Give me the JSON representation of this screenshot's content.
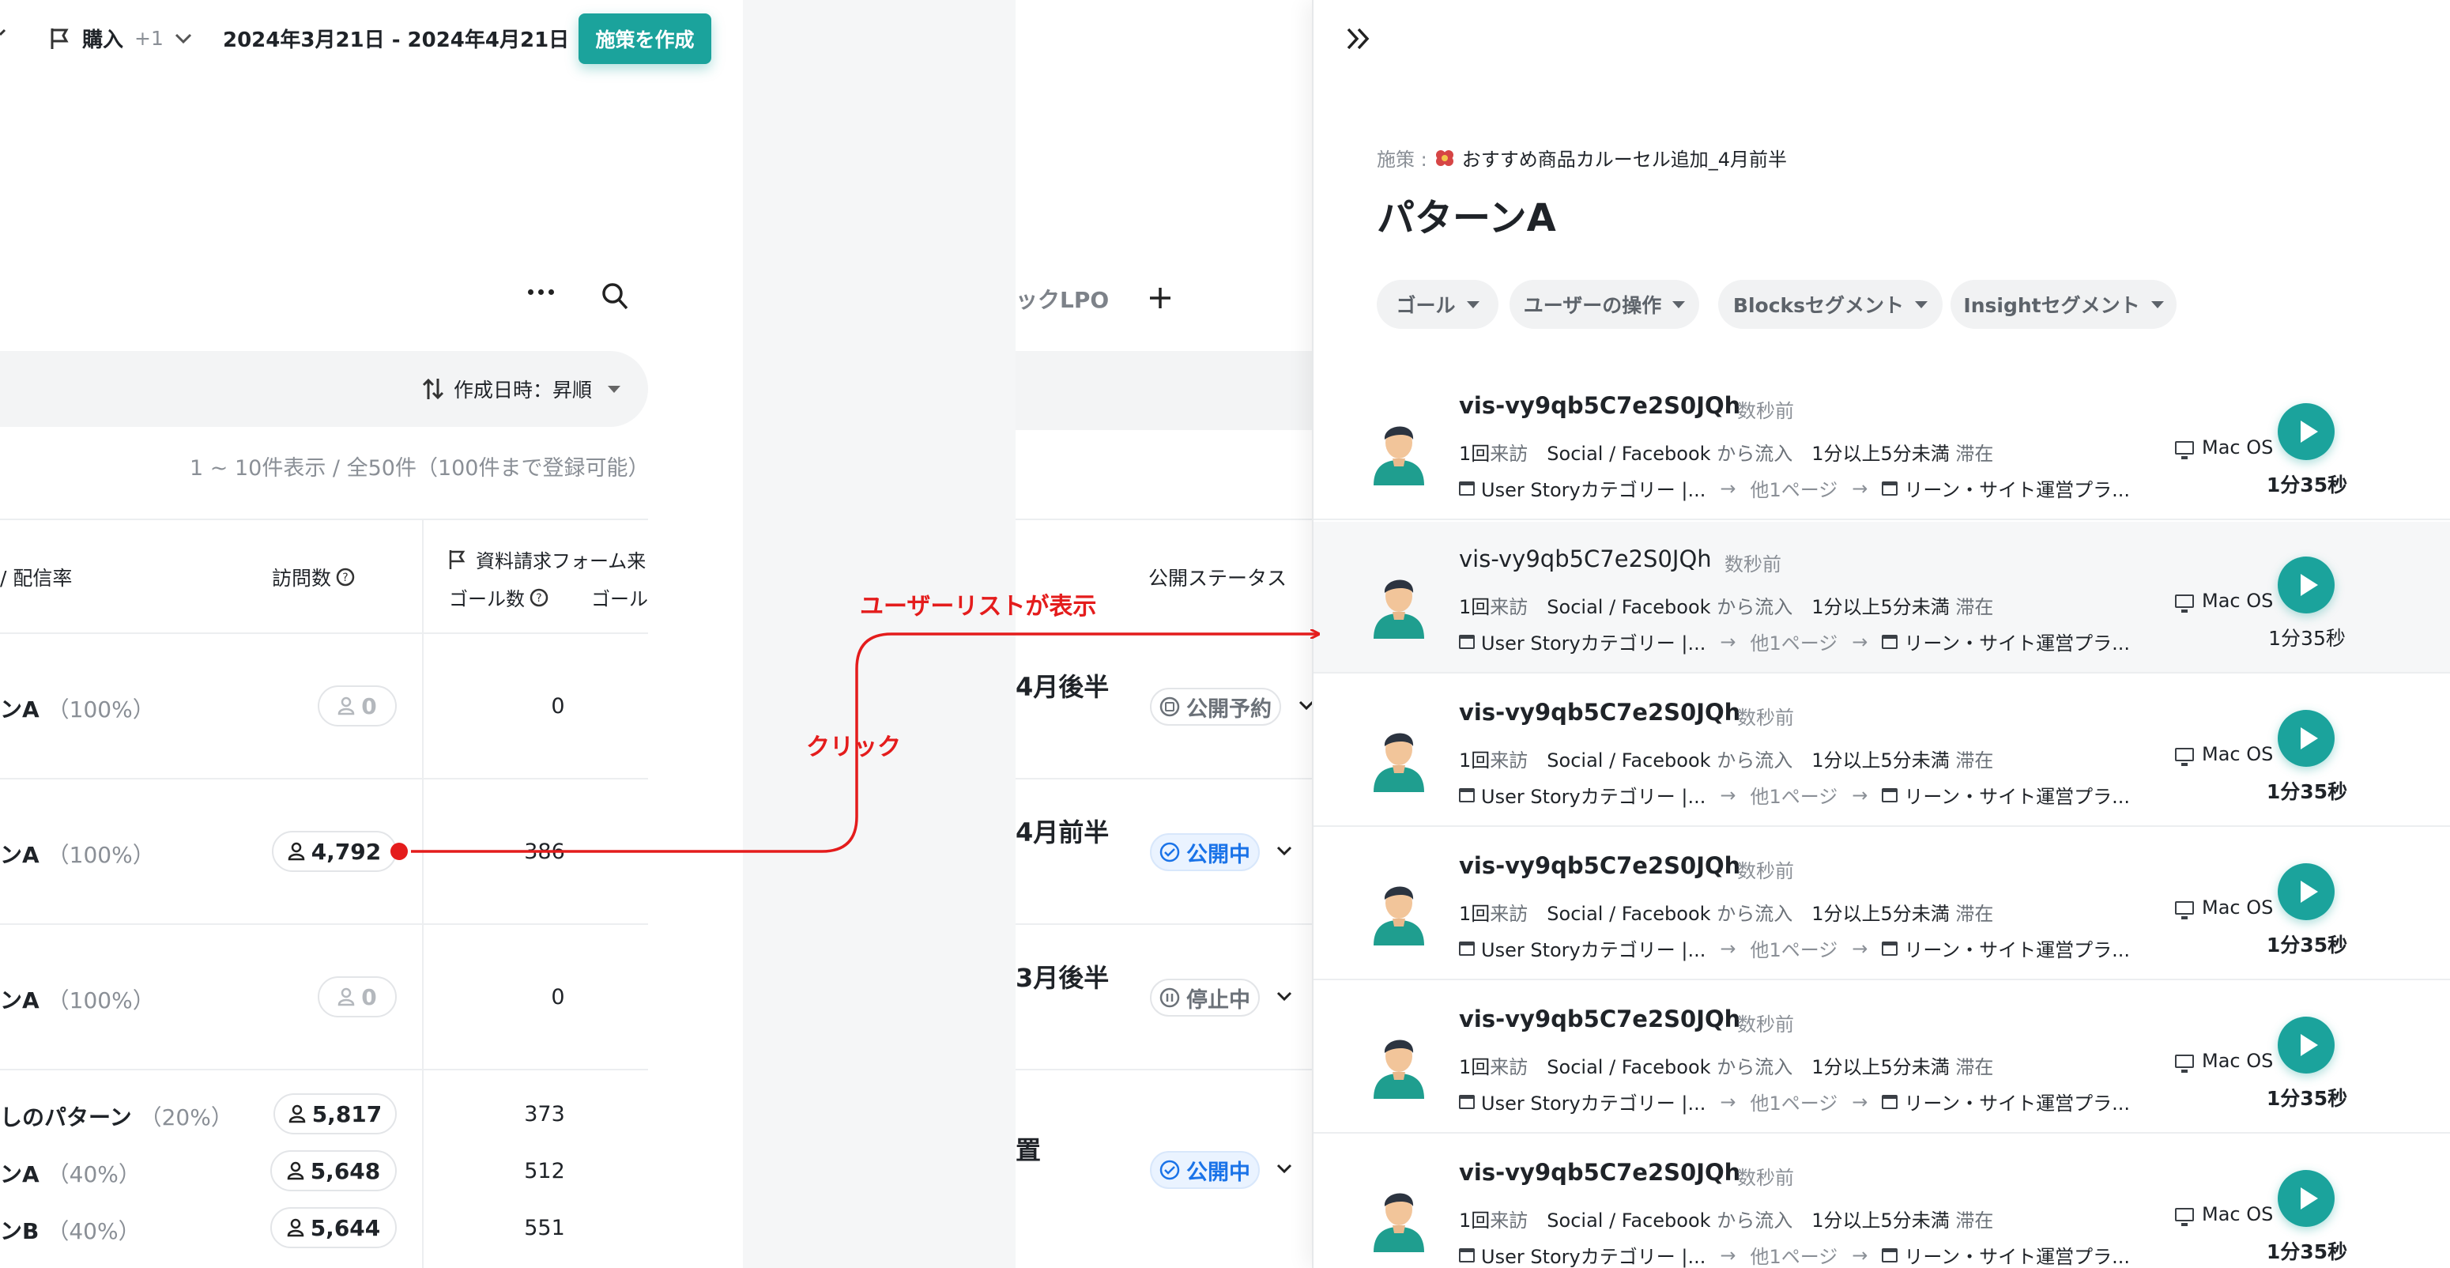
{
  "topbar": {
    "goal_label": "購入",
    "goal_extra": "+1",
    "date_range": "2024年3月21日 - 2024年4月21日",
    "create_button": "施策を作成"
  },
  "list": {
    "sort_label": "作成日時：昇順",
    "count_text": "1 ~ 10件表示 / 全50件（100件まで登録可能）",
    "headers": {
      "pattern_rate": "/ 配信率",
      "visits": "訪問数",
      "goal_form": "資料請求フォーム来",
      "goal_count": "ゴール数",
      "goal_trunc": "ゴール"
    },
    "rows": [
      {
        "name": "ンA",
        "pct": "（100%）",
        "visits": "0",
        "goals": "0"
      },
      {
        "name": "ンA",
        "pct": "（100%）",
        "visits": "4,792",
        "goals": "386"
      },
      {
        "name": "ンA",
        "pct": "（100%）",
        "visits": "0",
        "goals": "0"
      },
      {
        "name": "しのパターン",
        "pct": "（20%）",
        "visits": "5,817",
        "goals": "373"
      },
      {
        "name": "ンA",
        "pct": "（40%）",
        "visits": "5,648",
        "goals": "512"
      },
      {
        "name": "ンB",
        "pct": "（40%）",
        "visits": "5,644",
        "goals": "551"
      }
    ]
  },
  "center": {
    "tab_partial": "ックLPO",
    "status_header": "公開ステータス",
    "campaigns": [
      {
        "title": "4月後半",
        "status": "公開予約"
      },
      {
        "title": "4月前半",
        "status": "公開中"
      },
      {
        "title": "3月後半",
        "status": "停止中"
      },
      {
        "title": "置",
        "status": "公開中"
      }
    ]
  },
  "annotations": {
    "click": "クリック",
    "user_list_shown": "ユーザーリストが表示"
  },
  "panel": {
    "campaign_prefix": "施策 :",
    "campaign_name": "おすすめ商品カルーセル追加_4月前半",
    "title": "パターンA",
    "filters": [
      "ゴール",
      "ユーザーの操作",
      "Blocksセグメント",
      "Insightセグメント"
    ],
    "users": [
      {
        "id": "vis-vy9qb5C7e2S0JQh",
        "when": "数秒前",
        "visits_n": "1回",
        "visits_u": "来訪",
        "source": "Social / Facebook",
        "source_suffix": "から流入",
        "stay": "1分以上5分未満",
        "stay_suffix": "滞在",
        "page_from": "User Storyカテゴリー |...",
        "page_mid": "他1ページ",
        "page_to": "リーン・サイト運営プラ...",
        "os": "Mac OS",
        "duration": "1分35秒"
      },
      {
        "id": "vis-vy9qb5C7e2S0JQh",
        "when": "数秒前",
        "visits_n": "1回",
        "visits_u": "来訪",
        "source": "Social / Facebook",
        "source_suffix": "から流入",
        "stay": "1分以上5分未満",
        "stay_suffix": "滞在",
        "page_from": "User Storyカテゴリー |...",
        "page_mid": "他1ページ",
        "page_to": "リーン・サイト運営プラ...",
        "os": "Mac OS",
        "duration": "1分35秒"
      },
      {
        "id": "vis-vy9qb5C7e2S0JQh",
        "when": "数秒前",
        "visits_n": "1回",
        "visits_u": "来訪",
        "source": "Social / Facebook",
        "source_suffix": "から流入",
        "stay": "1分以上5分未満",
        "stay_suffix": "滞在",
        "page_from": "User Storyカテゴリー |...",
        "page_mid": "他1ページ",
        "page_to": "リーン・サイト運営プラ...",
        "os": "Mac OS",
        "duration": "1分35秒"
      },
      {
        "id": "vis-vy9qb5C7e2S0JQh",
        "when": "数秒前",
        "visits_n": "1回",
        "visits_u": "来訪",
        "source": "Social / Facebook",
        "source_suffix": "から流入",
        "stay": "1分以上5分未満",
        "stay_suffix": "滞在",
        "page_from": "User Storyカテゴリー |...",
        "page_mid": "他1ページ",
        "page_to": "リーン・サイト運営プラ...",
        "os": "Mac OS",
        "duration": "1分35秒"
      },
      {
        "id": "vis-vy9qb5C7e2S0JQh",
        "when": "数秒前",
        "visits_n": "1回",
        "visits_u": "来訪",
        "source": "Social / Facebook",
        "source_suffix": "から流入",
        "stay": "1分以上5分未満",
        "stay_suffix": "滞在",
        "page_from": "User Storyカテゴリー |...",
        "page_mid": "他1ページ",
        "page_to": "リーン・サイト運営プラ...",
        "os": "Mac OS",
        "duration": "1分35秒"
      },
      {
        "id": "vis-vy9qb5C7e2S0JQh",
        "when": "数秒前",
        "visits_n": "1回",
        "visits_u": "来訪",
        "source": "Social / Facebook",
        "source_suffix": "から流入",
        "stay": "1分以上5分未満",
        "stay_suffix": "滞在",
        "page_from": "User Storyカテゴリー |...",
        "page_mid": "他1ページ",
        "page_to": "リーン・サイト運営プラ...",
        "os": "Mac OS",
        "duration": "1分35秒"
      }
    ]
  },
  "colors": {
    "accent": "#1ba39c",
    "annotation": "#e41c1c",
    "live": "#1a73e8"
  }
}
